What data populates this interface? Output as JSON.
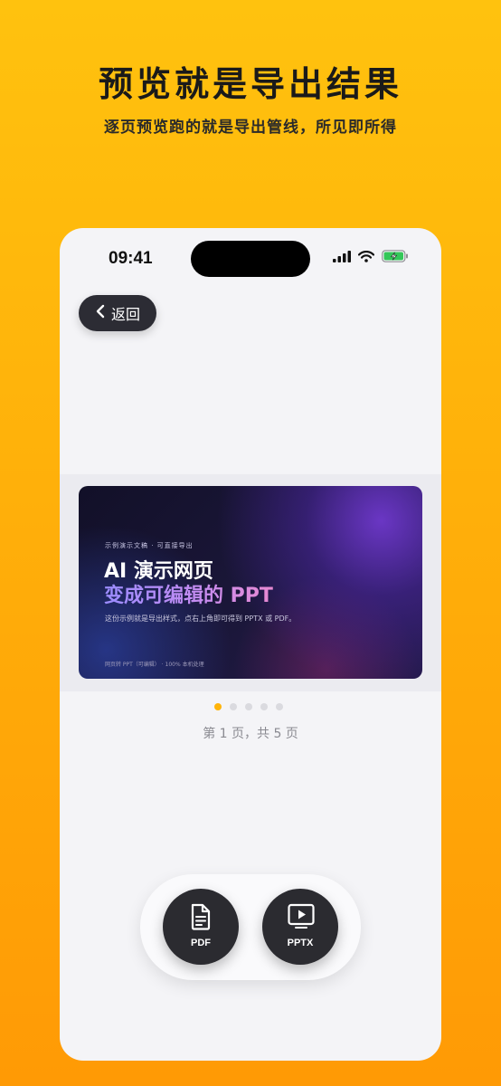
{
  "header": {
    "title": "预览就是导出结果",
    "subtitle": "逐页预览跑的就是导出管线，所见即所得"
  },
  "status_bar": {
    "time": "09:41",
    "icons": [
      "signal-icon",
      "wifi-icon",
      "battery-charging-icon"
    ]
  },
  "nav": {
    "back_label": "返回"
  },
  "slide": {
    "kicker": "示例演示文稿 · 可直接导出",
    "title_line1": "AI 演示网页",
    "title_line2": "变成可编辑的 PPT",
    "description": "这份示例就是导出样式，点右上角即可得到 PPTX 或 PDF。",
    "footer": "网页转 PPT（可编辑） · 100% 本机处理"
  },
  "pager": {
    "total_pages": 5,
    "current_page": 1,
    "label": "第 1 页，共 5 页"
  },
  "export": {
    "pdf_label": "PDF",
    "pptx_label": "PPTX"
  },
  "colors": {
    "background_top": "#FFC20E",
    "background_bottom": "#FF9A05",
    "accent_dot": "#FFB40A",
    "dark_button": "#2B2B30"
  }
}
